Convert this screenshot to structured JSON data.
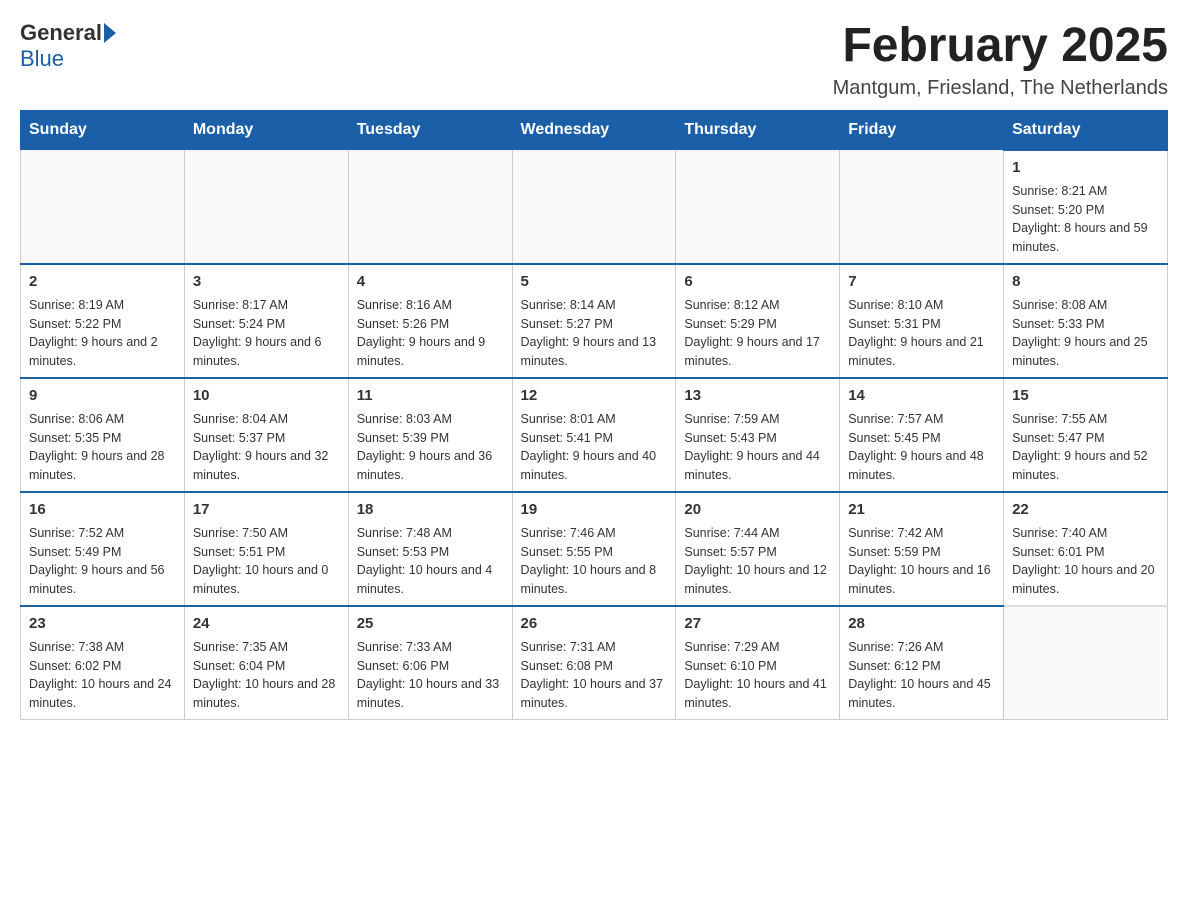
{
  "header": {
    "logo_general": "General",
    "logo_blue": "Blue",
    "month_title": "February 2025",
    "location": "Mantgum, Friesland, The Netherlands"
  },
  "weekdays": [
    "Sunday",
    "Monday",
    "Tuesday",
    "Wednesday",
    "Thursday",
    "Friday",
    "Saturday"
  ],
  "weeks": [
    [
      {
        "day": "",
        "empty": true
      },
      {
        "day": "",
        "empty": true
      },
      {
        "day": "",
        "empty": true
      },
      {
        "day": "",
        "empty": true
      },
      {
        "day": "",
        "empty": true
      },
      {
        "day": "",
        "empty": true
      },
      {
        "day": "1",
        "sunrise": "8:21 AM",
        "sunset": "5:20 PM",
        "daylight": "8 hours and 59 minutes."
      }
    ],
    [
      {
        "day": "2",
        "sunrise": "8:19 AM",
        "sunset": "5:22 PM",
        "daylight": "9 hours and 2 minutes."
      },
      {
        "day": "3",
        "sunrise": "8:17 AM",
        "sunset": "5:24 PM",
        "daylight": "9 hours and 6 minutes."
      },
      {
        "day": "4",
        "sunrise": "8:16 AM",
        "sunset": "5:26 PM",
        "daylight": "9 hours and 9 minutes."
      },
      {
        "day": "5",
        "sunrise": "8:14 AM",
        "sunset": "5:27 PM",
        "daylight": "9 hours and 13 minutes."
      },
      {
        "day": "6",
        "sunrise": "8:12 AM",
        "sunset": "5:29 PM",
        "daylight": "9 hours and 17 minutes."
      },
      {
        "day": "7",
        "sunrise": "8:10 AM",
        "sunset": "5:31 PM",
        "daylight": "9 hours and 21 minutes."
      },
      {
        "day": "8",
        "sunrise": "8:08 AM",
        "sunset": "5:33 PM",
        "daylight": "9 hours and 25 minutes."
      }
    ],
    [
      {
        "day": "9",
        "sunrise": "8:06 AM",
        "sunset": "5:35 PM",
        "daylight": "9 hours and 28 minutes."
      },
      {
        "day": "10",
        "sunrise": "8:04 AM",
        "sunset": "5:37 PM",
        "daylight": "9 hours and 32 minutes."
      },
      {
        "day": "11",
        "sunrise": "8:03 AM",
        "sunset": "5:39 PM",
        "daylight": "9 hours and 36 minutes."
      },
      {
        "day": "12",
        "sunrise": "8:01 AM",
        "sunset": "5:41 PM",
        "daylight": "9 hours and 40 minutes."
      },
      {
        "day": "13",
        "sunrise": "7:59 AM",
        "sunset": "5:43 PM",
        "daylight": "9 hours and 44 minutes."
      },
      {
        "day": "14",
        "sunrise": "7:57 AM",
        "sunset": "5:45 PM",
        "daylight": "9 hours and 48 minutes."
      },
      {
        "day": "15",
        "sunrise": "7:55 AM",
        "sunset": "5:47 PM",
        "daylight": "9 hours and 52 minutes."
      }
    ],
    [
      {
        "day": "16",
        "sunrise": "7:52 AM",
        "sunset": "5:49 PM",
        "daylight": "9 hours and 56 minutes."
      },
      {
        "day": "17",
        "sunrise": "7:50 AM",
        "sunset": "5:51 PM",
        "daylight": "10 hours and 0 minutes."
      },
      {
        "day": "18",
        "sunrise": "7:48 AM",
        "sunset": "5:53 PM",
        "daylight": "10 hours and 4 minutes."
      },
      {
        "day": "19",
        "sunrise": "7:46 AM",
        "sunset": "5:55 PM",
        "daylight": "10 hours and 8 minutes."
      },
      {
        "day": "20",
        "sunrise": "7:44 AM",
        "sunset": "5:57 PM",
        "daylight": "10 hours and 12 minutes."
      },
      {
        "day": "21",
        "sunrise": "7:42 AM",
        "sunset": "5:59 PM",
        "daylight": "10 hours and 16 minutes."
      },
      {
        "day": "22",
        "sunrise": "7:40 AM",
        "sunset": "6:01 PM",
        "daylight": "10 hours and 20 minutes."
      }
    ],
    [
      {
        "day": "23",
        "sunrise": "7:38 AM",
        "sunset": "6:02 PM",
        "daylight": "10 hours and 24 minutes."
      },
      {
        "day": "24",
        "sunrise": "7:35 AM",
        "sunset": "6:04 PM",
        "daylight": "10 hours and 28 minutes."
      },
      {
        "day": "25",
        "sunrise": "7:33 AM",
        "sunset": "6:06 PM",
        "daylight": "10 hours and 33 minutes."
      },
      {
        "day": "26",
        "sunrise": "7:31 AM",
        "sunset": "6:08 PM",
        "daylight": "10 hours and 37 minutes."
      },
      {
        "day": "27",
        "sunrise": "7:29 AM",
        "sunset": "6:10 PM",
        "daylight": "10 hours and 41 minutes."
      },
      {
        "day": "28",
        "sunrise": "7:26 AM",
        "sunset": "6:12 PM",
        "daylight": "10 hours and 45 minutes."
      },
      {
        "day": "",
        "empty": true
      }
    ]
  ]
}
